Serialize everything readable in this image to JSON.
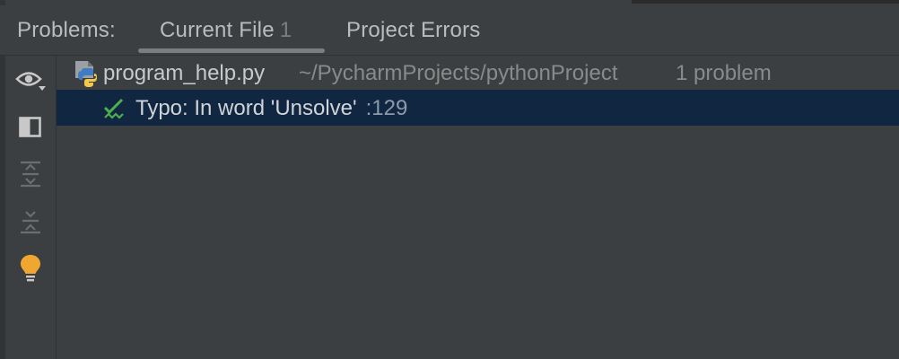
{
  "panel": {
    "title": "Problems:",
    "tabs": [
      {
        "label": "Current File",
        "count": "1"
      },
      {
        "label": "Project Errors"
      }
    ]
  },
  "toolbar": {
    "buttons": [
      {
        "icon": "eye-icon"
      },
      {
        "icon": "preview-panel-icon"
      },
      {
        "icon": "expand-all-icon"
      },
      {
        "icon": "collapse-all-icon"
      },
      {
        "icon": "lightbulb-icon"
      }
    ]
  },
  "tree": {
    "file": {
      "name": "program_help.py",
      "path": "~/PycharmProjects/pythonProject",
      "problems": "1 problem"
    },
    "problems": [
      {
        "text": "Typo: In word 'Unsolve'",
        "line": ":129"
      }
    ]
  },
  "colors": {
    "background": "#3c3f41",
    "selection": "#112640",
    "typo_green": "#4caf50",
    "bulb_yellow": "#f0a732"
  }
}
